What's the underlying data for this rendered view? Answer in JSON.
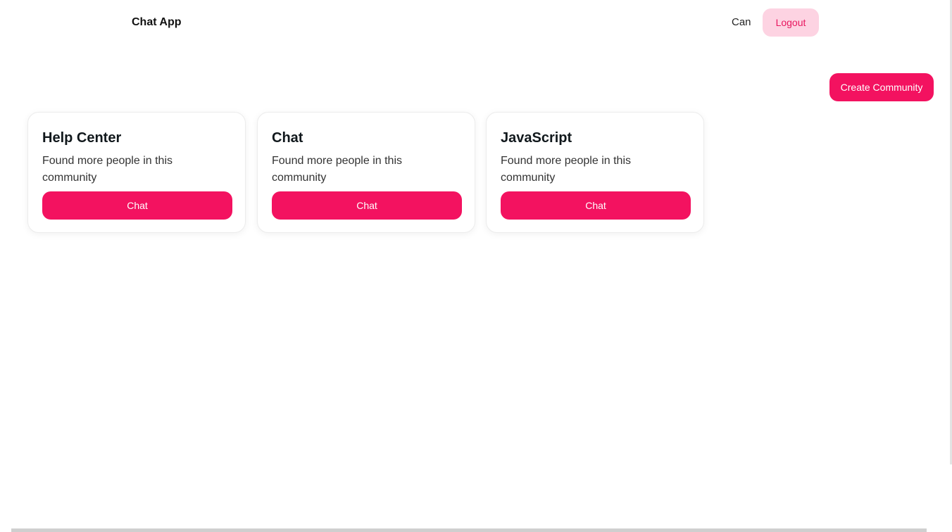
{
  "header": {
    "brand": "Chat App",
    "username": "Can",
    "logout_label": "Logout"
  },
  "actions": {
    "create_label": "Create Community"
  },
  "communities": [
    {
      "title": "Help Center",
      "description": "Found more people in this community",
      "button_label": "Chat"
    },
    {
      "title": "Chat",
      "description": "Found more people in this community",
      "button_label": "Chat"
    },
    {
      "title": "JavaScript",
      "description": "Found more people in this community",
      "button_label": "Chat"
    }
  ],
  "colors": {
    "accent": "#f31260",
    "accent_soft": "#fdd3e2",
    "accent_text": "#e8175f"
  }
}
